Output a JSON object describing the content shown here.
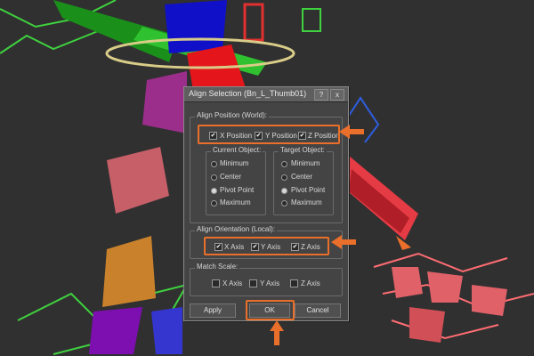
{
  "dialog": {
    "title": "Align Selection (Bn_L_Thumb01)",
    "help_label": "?",
    "close_label": "x"
  },
  "align_position": {
    "group_label": "Align Position (World):",
    "x_label": "X Position",
    "y_label": "Y Position",
    "z_label": "Z Position",
    "x_checked": true,
    "y_checked": true,
    "z_checked": true
  },
  "current_object": {
    "group_label": "Current Object:",
    "options": [
      "Minimum",
      "Center",
      "Pivot Point",
      "Maximum"
    ],
    "selected": "Pivot Point"
  },
  "target_object": {
    "group_label": "Target Object:",
    "options": [
      "Minimum",
      "Center",
      "Pivot Point",
      "Maximum"
    ],
    "selected": "Pivot Point"
  },
  "align_orientation": {
    "group_label": "Align Orientation (Local):",
    "x_label": "X Axis",
    "y_label": "Y Axis",
    "z_label": "Z Axis",
    "x_checked": true,
    "y_checked": true,
    "z_checked": true
  },
  "match_scale": {
    "group_label": "Match Scale:",
    "x_label": "X Axis",
    "y_label": "Y Axis",
    "z_label": "Z Axis",
    "x_checked": false,
    "y_checked": false,
    "z_checked": false
  },
  "buttons": {
    "apply": "Apply",
    "ok": "OK",
    "cancel": "Cancel"
  },
  "colors": {
    "highlight": "#ea6f2a",
    "dialog_bg": "#444444",
    "viewport_bg": "#303030"
  }
}
